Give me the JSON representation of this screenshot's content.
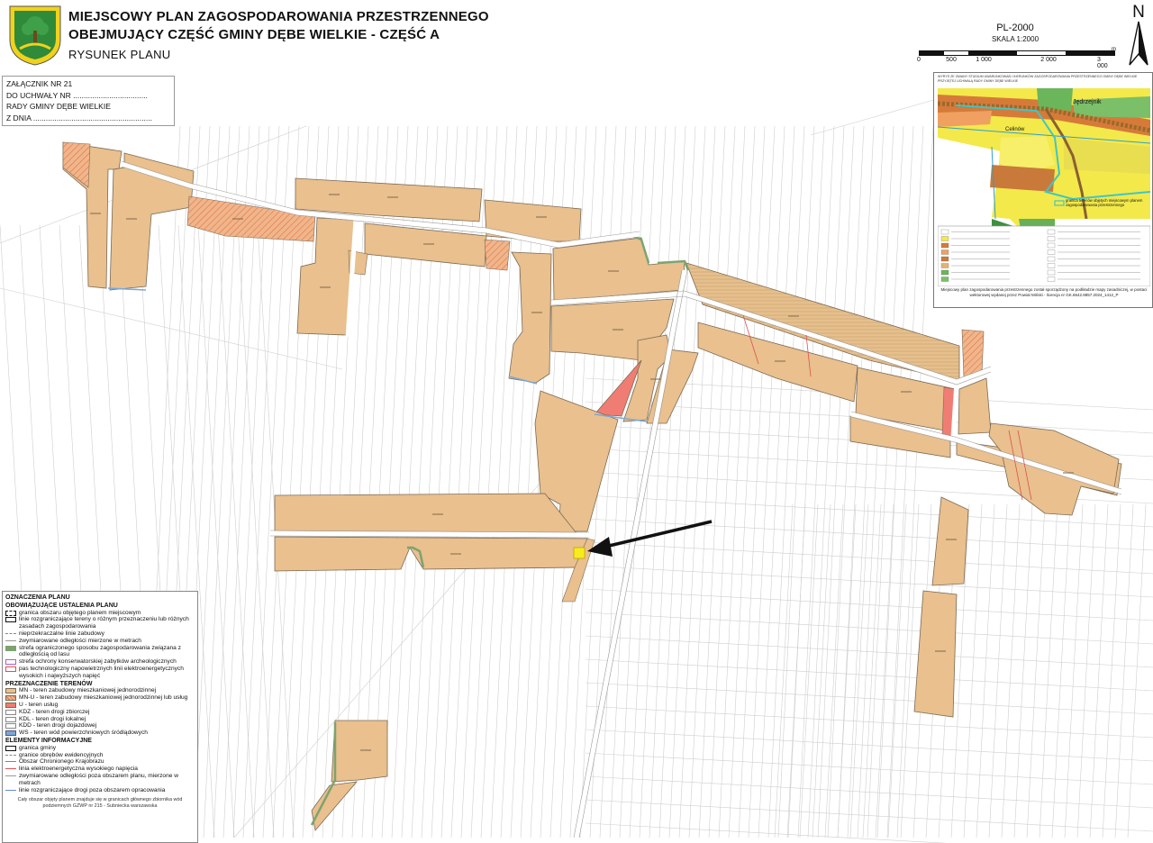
{
  "header": {
    "title_line1": "MIEJSCOWY PLAN ZAGOSPODAROWANIA PRZESTRZENNEGO",
    "title_line2": "OBEJMUJĄCY CZĘŚĆ GMINY DĘBE WIELKIE - CZĘŚĆ A",
    "subtitle": "RYSUNEK PLANU"
  },
  "scale": {
    "code": "PL-2000",
    "ratio": "SKALA 1:2000",
    "unit": "m",
    "ticks": [
      "0",
      "500",
      "1 000",
      "2 000",
      "3 000"
    ]
  },
  "north_label": "N",
  "annex": {
    "line1": "ZAŁĄCZNIK NR 21",
    "line2": "DO UCHWAŁY NR ...................................",
    "line3": "RADY GMINY DĘBE WIELKIE",
    "line4": "Z DNIA ........................................................"
  },
  "inset": {
    "header_text": "WYRYS ZE ZMIANY STUDIUM UWARUNKOWAŃ I KIERUNKÓW ZAGOSPODAROWANIA PRZESTRZENNEGO GMINY DĘBE WIELKIE PRZYJĘTEJ UCHWAŁĄ RADY GMINY DĘBE WIELKIE",
    "place_1": "Jędrzejnik",
    "place_2": "Celinów",
    "inset_legend_boundary": "granica terenów objętych miejscowym planem zagospodarowania przestrzennego",
    "footer": "Miejscowy plan zagospodarowania przestrzennego został sporządzony na podkładzie mapy zasadniczej, w postaci wektorowej wydanej przez Powiat Miński - licencja nr GK.6642.8857.2024_1412_P"
  },
  "legend": {
    "title": "OZNACZENIA PLANU",
    "section1": "OBOWIĄZUJĄCE USTALENIA PLANU",
    "items1": [
      {
        "text": "granica obszaru objętego planem miejscowym",
        "swatch": "dash-black"
      },
      {
        "text": "linie rozgraniczające tereny o różnym przeznaczeniu lub różnych zasadach zagospodarowania",
        "swatch": "line-black"
      },
      {
        "text": "nieprzekraczalne linie zabudowy",
        "swatch": "dash-gray"
      },
      {
        "text": "zwymiarowane odległości mierzone w metrach",
        "swatch": "line-gray"
      },
      {
        "text": "strefa ograniczonego sposobu zagospodarowania związana z odległością od lasu",
        "swatch": "green"
      },
      {
        "text": "strefa ochrony konserwatorskiej zabytków archeologicznych",
        "swatch": "purple"
      },
      {
        "text": "pas technologiczny napowietrznych linii elektroenergetycznych wysokich i najwyższych napięć",
        "swatch": "red-outline"
      }
    ],
    "section2": "PRZEZNACZENIE TERENÓW",
    "items2": [
      {
        "text": "MN - teren zabudowy mieszkaniowej jednorodzinnej",
        "swatch": "mn"
      },
      {
        "text": "MN-U - teren zabudowy mieszkaniowej jednorodzinnej lub usług",
        "swatch": "mnu"
      },
      {
        "text": "U - teren usług",
        "swatch": "u"
      },
      {
        "text": "KDZ - teren drogi zbiorczej",
        "swatch": "road"
      },
      {
        "text": "KDL - teren drogi lokalnej",
        "swatch": "road"
      },
      {
        "text": "KDD - teren drogi dojazdowej",
        "swatch": "road"
      },
      {
        "text": "WS - teren wód powierzchniowych śródlądowych",
        "swatch": "water"
      }
    ],
    "section3": "ELEMENTY INFORMACYJNE",
    "items3": [
      {
        "text": "granica gminy",
        "swatch": "line-black"
      },
      {
        "text": "granice obrębów ewidencyjnych",
        "swatch": "dash-gray"
      },
      {
        "text": "Obszar Chronionego Krajobrazu",
        "swatch": "green-line"
      },
      {
        "text": "linia elektroenergetyczna wysokiego napięcia",
        "swatch": "red-line"
      },
      {
        "text": "zwymiarowane odległości poza obszarem planu, mierzone w metrach",
        "swatch": "line-gray"
      },
      {
        "text": "linie rozgraniczające drogi poza obszarem opracowania",
        "swatch": "line-blue"
      }
    ],
    "note": "Cały obszar objęty planem znajduje się w granicach głównego zbiornika wód podziemnych GZWP nr 215 - Subniecka warszawska"
  },
  "colors": {
    "mn": "#e9c08e",
    "mnu": "#f2a981",
    "u": "#f07d73",
    "road": "#ffffff",
    "water": "#7aa8d8",
    "forest_strip": "#7ea370",
    "highlight": "#f7ec1e",
    "arrow": "#111111"
  }
}
